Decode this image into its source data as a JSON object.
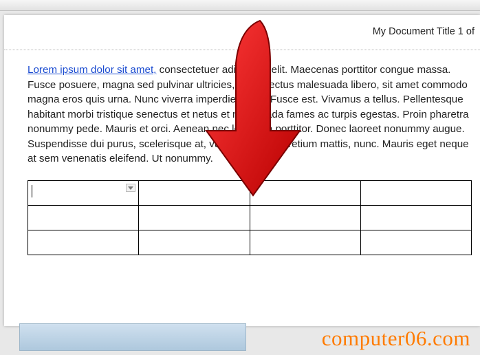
{
  "header": {
    "title": "My Document Title 1 of "
  },
  "body": {
    "link_text": "Lorem ipsum dolor sit amet,",
    "para_rest": " consectetuer adipiscing elit. Maecenas porttitor congue massa. Fusce posuere, magna sed pulvinar ultricies, purus lectus malesuada libero, sit amet commodo magna eros quis urna. Nunc viverra imperdiet enim. Fusce est. Vivamus a tellus. Pellentesque habitant morbi tristique senectus et netus et malesuada fames ac turpis egestas. Proin pharetra nonummy pede. Mauris et orci. Aenean nec lorem. In porttitor. Donec laoreet nonummy augue. Suspendisse dui purus, scelerisque at, vulputate vitae, pretium mattis, nunc. Mauris eget neque at sem venenatis eleifend. Ut nonummy."
  },
  "table": {
    "rows": 3,
    "cols": 4,
    "active_cell": {
      "row": 0,
      "col": 0
    }
  },
  "watermark": "computer06.com",
  "arrow": {
    "color": "#e21b1b"
  }
}
